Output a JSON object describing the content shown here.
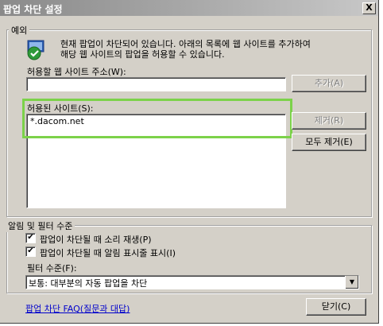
{
  "window": {
    "title": "팝업 차단 설정",
    "close_glyph": "X"
  },
  "exceptions": {
    "group_label": "예외",
    "info_line1": "현재 팝업이 차단되어 있습니다. 아래의 목록에 웹 사이트를 추가하여",
    "info_line2": "해당 웹 사이트의 팝업을 허용할 수 있습니다.",
    "address_label": "허용할 웹 사이트 주소(W):",
    "address_value": "",
    "add_button": "추가(A)",
    "allowed_label": "허용된 사이트(S):",
    "allowed_sites": [
      "*.dacom.net"
    ],
    "remove_button": "제거(R)",
    "remove_all_button": "모두 제거(E)"
  },
  "notify": {
    "group_label": "알림 및 필터 수준",
    "sound_label": "팝업이 차단될 때 소리 재생(P)",
    "sound_checked": true,
    "infobar_label": "팝업이 차단될 때 알림 표시줄 표시(I)",
    "infobar_checked": true,
    "filter_label": "필터 수준(F):",
    "filter_value": "보통: 대부분의 자동 팝업을 차단"
  },
  "footer": {
    "faq_link": "팝업 차단 FAQ(질문과 대답)",
    "close_button": "닫기(C)"
  },
  "colors": {
    "highlight": "#7cd24a"
  }
}
